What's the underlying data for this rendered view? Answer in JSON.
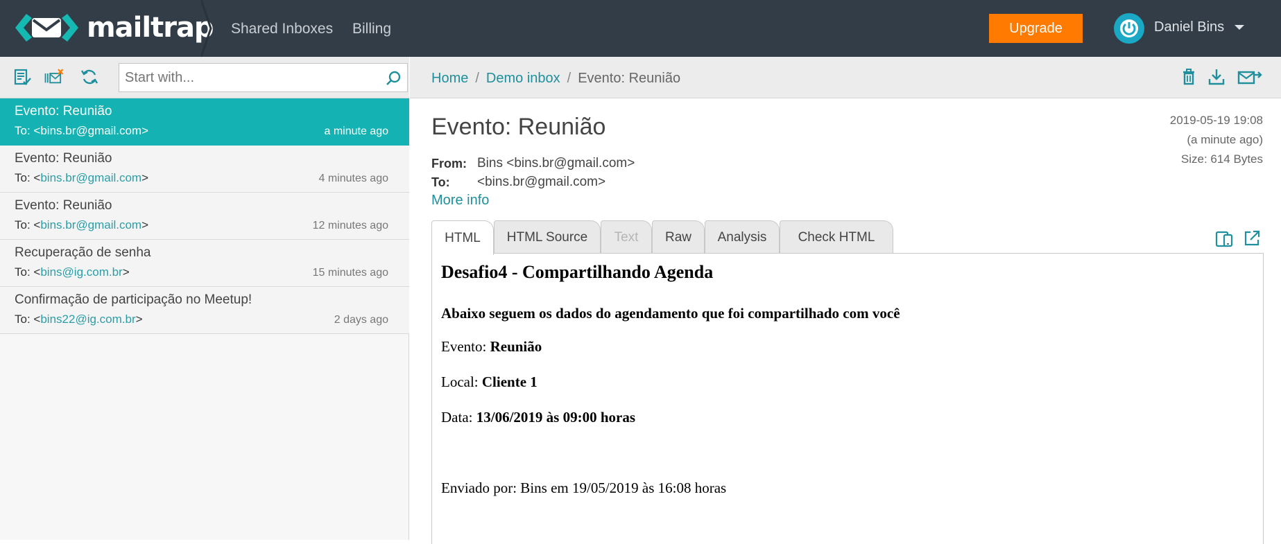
{
  "header": {
    "logo_text": "mailtrap",
    "nav": [
      "Shared Inboxes",
      "Billing"
    ],
    "upgrade_label": "Upgrade",
    "user_name": "Daniel Bins"
  },
  "search": {
    "placeholder": "Start with..."
  },
  "messages": [
    {
      "subject": "Evento: Reunião",
      "to_prefix": "To: ",
      "to": "<bins.br@gmail.com>",
      "time": "a minute ago",
      "active": true
    },
    {
      "subject": "Evento: Reunião",
      "to_prefix": "To: <",
      "to": "bins.br@gmail.com",
      "to_suffix": ">",
      "time": "4 minutes ago"
    },
    {
      "subject": "Evento: Reunião",
      "to_prefix": "To: <",
      "to": "bins.br@gmail.com",
      "to_suffix": ">",
      "time": "12 minutes ago"
    },
    {
      "subject": "Recuperação de senha",
      "to_prefix": "To: <",
      "to": "bins@ig.com.br",
      "to_suffix": ">",
      "time": "15 minutes ago"
    },
    {
      "subject": "Confirmação de participação no Meetup!",
      "to_prefix": "To: <",
      "to": "bins22@ig.com.br",
      "to_suffix": ">",
      "time": "2 days ago"
    }
  ],
  "breadcrumb": {
    "home": "Home",
    "inbox": "Demo inbox",
    "current": "Evento: Reunião",
    "sep": "/"
  },
  "email": {
    "subject": "Evento: Reunião",
    "date": "2019-05-19 19:08",
    "relative": "(a minute ago)",
    "size": "Size: 614 Bytes",
    "from_label": "From:",
    "from": "Bins <bins.br@gmail.com>",
    "to_label": "To:",
    "to": "<bins.br@gmail.com>",
    "more_info": "More info"
  },
  "tabs": [
    "HTML",
    "HTML Source",
    "Text",
    "Raw",
    "Analysis",
    "Check HTML"
  ],
  "body": {
    "h1": "Desafio4 - Compartilhando Agenda",
    "h3": "Abaixo seguem os dados do agendamento que foi compartilhado com você",
    "evento_label": "Evento: ",
    "evento": "Reunião",
    "local_label": "Local: ",
    "local": "Cliente 1",
    "data_label": "Data: ",
    "data": "13/06/2019 às 09:00 horas",
    "footer": "Enviado por: Bins em 19/05/2019 às 16:08 horas"
  },
  "colors": {
    "topbar": "#333d47",
    "accent": "#14b2b2",
    "upgrade": "#ff7a00",
    "link": "#1f8f9d"
  }
}
